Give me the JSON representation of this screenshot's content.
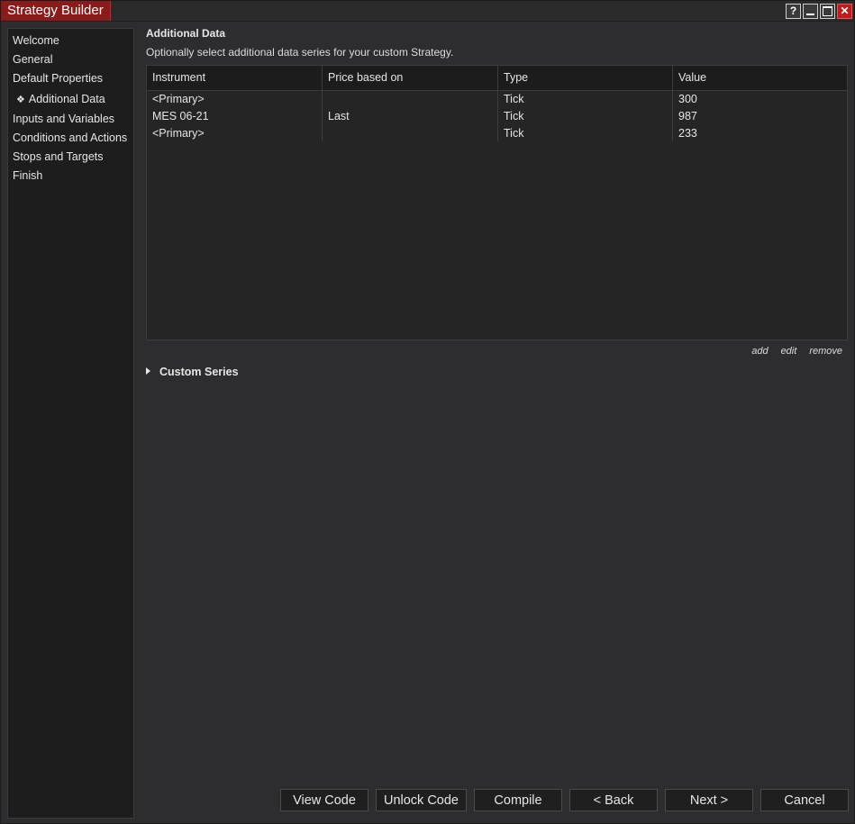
{
  "window": {
    "title": "Strategy Builder",
    "controls": [
      "?",
      "—",
      "□",
      "✕"
    ],
    "accent_color": "#8b1a1a"
  },
  "sidebar": {
    "items": [
      {
        "label": "Welcome"
      },
      {
        "label": "General"
      },
      {
        "label": "Default Properties"
      },
      {
        "label": "Additional Data",
        "active": true,
        "bullet": "❖"
      },
      {
        "label": "Inputs and Variables"
      },
      {
        "label": "Conditions and Actions"
      },
      {
        "label": "Stops and Targets"
      },
      {
        "label": "Finish"
      }
    ]
  },
  "main": {
    "title": "Additional Data",
    "description": "Optionally select additional data series for your custom Strategy.",
    "grid": {
      "columns": [
        "Instrument",
        "Price based on",
        "Type",
        "Value"
      ],
      "rows": [
        [
          "<Primary>",
          "",
          "Tick",
          "300"
        ],
        [
          "MES 06-21",
          "Last",
          "Tick",
          "987"
        ],
        [
          "<Primary>",
          "",
          "Tick",
          "233"
        ]
      ]
    },
    "grid_actions": {
      "add": "add",
      "edit": "edit",
      "remove": "remove"
    },
    "custom_series": {
      "label": "Custom Series",
      "icon": "expand-triangle-icon"
    }
  },
  "footer": {
    "view_code": "View Code",
    "unlock_code": "Unlock Code",
    "compile": "Compile",
    "back": "< Back",
    "next": "Next >",
    "cancel": "Cancel"
  }
}
